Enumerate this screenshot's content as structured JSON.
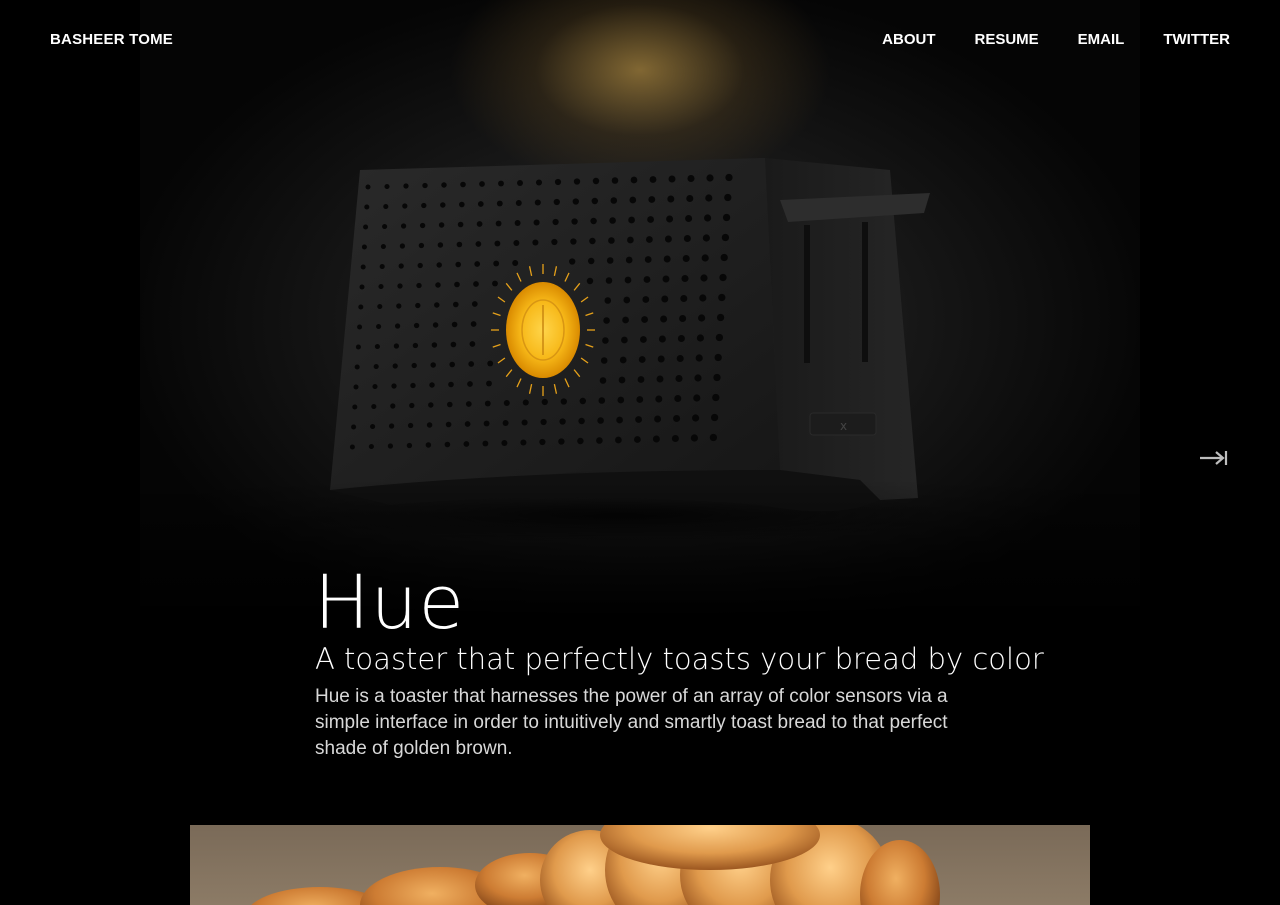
{
  "header": {
    "brand": "BASHEER TOME",
    "nav": [
      "ABOUT",
      "RESUME",
      "EMAIL",
      "TWITTER"
    ]
  },
  "hero": {
    "image_subject": "black toaster with glowing yellow dial",
    "next_icon": "skip-next-icon"
  },
  "project": {
    "title": "Hue",
    "subtitle": "A toaster that perfectly toasts your bread by color",
    "description": "Hue is a toaster that harnesses the power of an array of color sensors via a simple interface in order to intuitively and smartly toast bread to that perfect shade of golden brown."
  },
  "colors": {
    "background": "#000000",
    "accent_glow": "#f7c631",
    "text_secondary": "#d8d8d8"
  }
}
